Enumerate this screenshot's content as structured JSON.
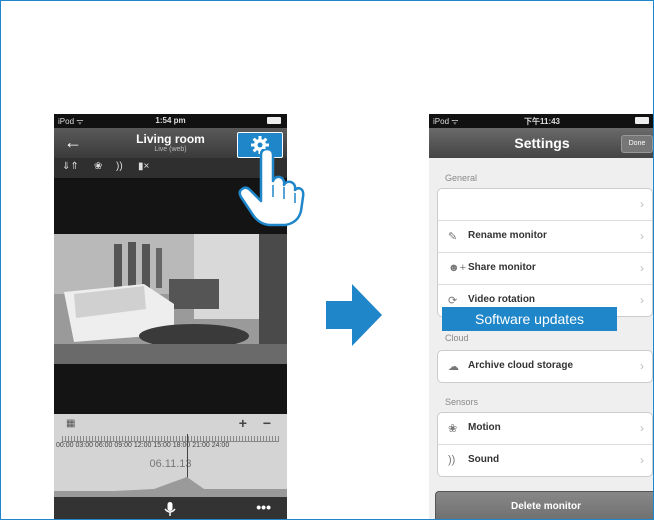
{
  "left_phone": {
    "status_carrier": "iPod ᯤ",
    "status_time": "1:54 pm",
    "back_icon": "arrow-left-icon",
    "title": "Living room",
    "subtitle": "Live (web)",
    "settings_icon": "gear-icon",
    "toolbar_icons": [
      "signal-bars-icon",
      "motion-icon",
      "sound-icon",
      "speaker-mute-icon"
    ],
    "timeline": {
      "calendar_icon": "calendar-icon",
      "zoom": "+  −",
      "hours": "00:00 03:00 06:00 09:00 12:00 15:00 18:00 21:00 24:00",
      "date": "06.11.13"
    },
    "mic_icon": "microphone-icon",
    "more_label": "•••"
  },
  "right_phone": {
    "status_carrier": "iPod ᯤ",
    "status_time": "下午11:43",
    "title": "Settings",
    "done_label": "Done",
    "sections": {
      "general": "General",
      "cloud": "Cloud",
      "sensors": "Sensors"
    },
    "general_items": [
      "",
      "Rename monitor",
      "Share monitor",
      "Video rotation"
    ],
    "cloud_items": [
      "Archive cloud storage"
    ],
    "sensor_items": [
      "Motion",
      "Sound"
    ],
    "highlight_label": "Software updates",
    "delete_label": "Delete monitor"
  },
  "colors": {
    "accent": "#1e86c9"
  }
}
